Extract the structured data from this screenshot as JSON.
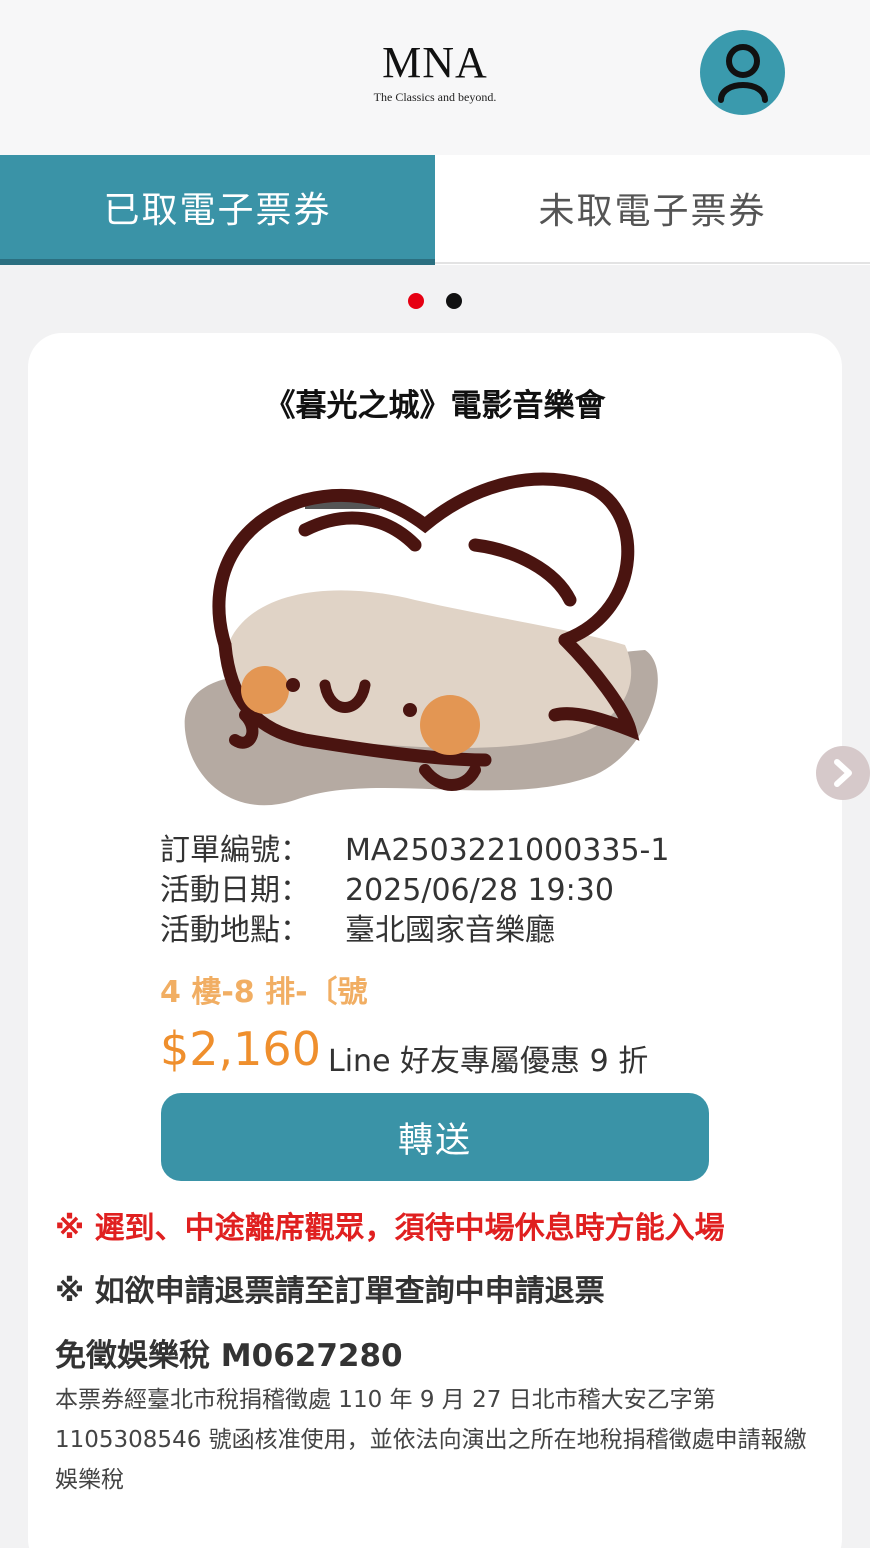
{
  "header": {
    "logo_main": "MNA",
    "logo_sub": "The Classics and beyond."
  },
  "tabs": [
    {
      "label": "已取電子票券",
      "active": true
    },
    {
      "label": "未取電子票券",
      "active": false
    }
  ],
  "pagination": {
    "active_color": "#e60012",
    "inactive_color": "#111111"
  },
  "ticket": {
    "title": "《暮光之城》電影音樂會",
    "order_label": "訂單編號：",
    "order_value": "MA2503221000335-1",
    "date_label": "活動日期：",
    "date_value": "2025/06/28 19:30",
    "venue_label": "活動地點：",
    "venue_value": "臺北國家音樂廳",
    "seat": "4 樓-8 排-〔號",
    "price": "$2,160",
    "promo": "Line 好友專屬優惠 9 折"
  },
  "actions": {
    "transfer_label": "轉送"
  },
  "notices": {
    "late_notice": "※ 遲到、中途離席觀眾，須待中場休息時方能入場",
    "refund_notice": "※ 如欲申請退票請至訂單查詢中申請退票",
    "tax_title": "免徵娛樂稅 M0627280",
    "tax_body": "本票券經臺北市稅捐稽徵處 110 年 9 月 27 日北市稽大安乙字第 1105308546 號函核准使用，並依法向演出之所在地稅捐稽徵處申請報繳娛樂稅"
  },
  "colors": {
    "brand": "#3a93a7",
    "price": "#ef8f2d",
    "seat": "#f1ae63",
    "warning": "#e02020"
  },
  "icons": {
    "avatar": "user-icon",
    "next": "chevron-right-icon",
    "qr_overlay": "cat-sticker-icon"
  }
}
